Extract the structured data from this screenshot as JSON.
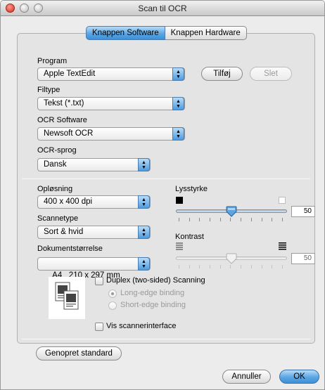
{
  "window": {
    "title": "Scan til OCR"
  },
  "tabs": [
    {
      "label": "Knappen Software",
      "active": true
    },
    {
      "label": "Knappen Hardware",
      "active": false
    }
  ],
  "program": {
    "label": "Program",
    "value": "Apple TextEdit",
    "add_button": "Tilføj",
    "delete_button": "Slet"
  },
  "filetype": {
    "label": "Filtype",
    "value": "Tekst (*.txt)"
  },
  "ocr_software": {
    "label": "OCR Software",
    "value": "Newsoft OCR"
  },
  "ocr_language": {
    "label": "OCR-sprog",
    "value": "Dansk"
  },
  "resolution": {
    "label": "Opløsning",
    "value": "400 x 400 dpi"
  },
  "scan_type": {
    "label": "Scannetype",
    "value": "Sort & hvid"
  },
  "document_size": {
    "label": "Dokumentstørrelse",
    "value": "A4   210 x 297 mm"
  },
  "brightness": {
    "label": "Lysstyrke",
    "value": "50",
    "level_percent": 50,
    "enabled": true
  },
  "contrast": {
    "label": "Kontrast",
    "value": "50",
    "level_percent": 50,
    "enabled": false
  },
  "duplex": {
    "label": "Duplex (two-sided) Scanning",
    "checked": false,
    "long_edge": "Long-edge binding",
    "short_edge": "Short-edge binding"
  },
  "show_interface": {
    "label": "Vis scannerinterface",
    "checked": false
  },
  "buttons": {
    "restore_default": "Genopret standard",
    "cancel": "Annuller",
    "ok": "OK"
  },
  "colors": {
    "accent": "#5aa6e4",
    "window_bg": "#ececec"
  }
}
